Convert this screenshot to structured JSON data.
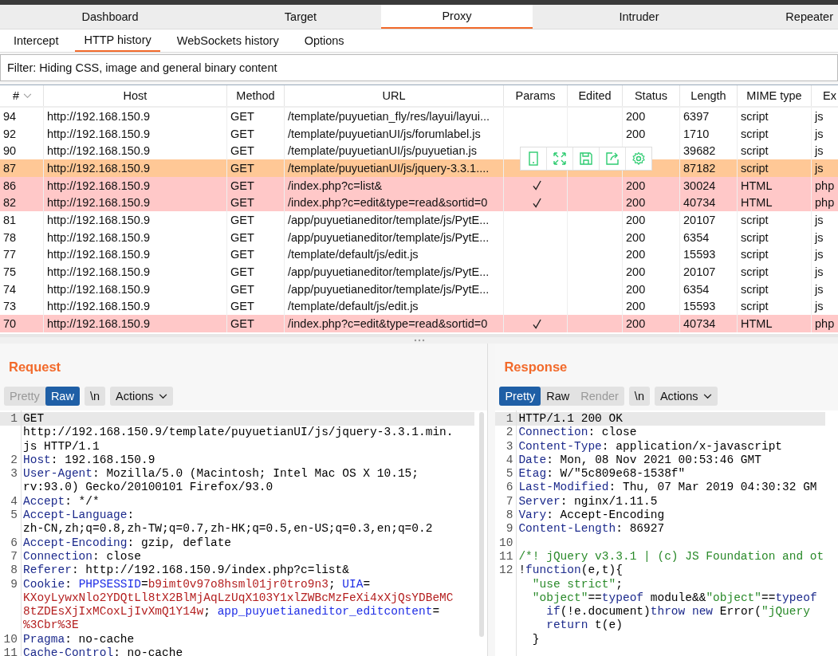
{
  "main_tabs": [
    {
      "label": "Dashboard",
      "selected": false
    },
    {
      "label": "Target",
      "selected": false
    },
    {
      "label": "Proxy",
      "selected": true
    },
    {
      "label": "Intruder",
      "selected": false
    },
    {
      "label": "Repeater",
      "selected": false
    }
  ],
  "sub_tabs": [
    {
      "label": "Intercept",
      "selected": false
    },
    {
      "label": "HTTP history",
      "selected": true
    },
    {
      "label": "WebSockets history",
      "selected": false
    },
    {
      "label": "Options",
      "selected": false
    }
  ],
  "filter": "Filter: Hiding CSS, image and general binary content",
  "table": {
    "columns": [
      "#",
      "Host",
      "Method",
      "URL",
      "Params",
      "Edited",
      "Status",
      "Length",
      "MIME type",
      "Ex"
    ],
    "rows": [
      {
        "number": "94",
        "host": "http://192.168.150.9",
        "method": "GET",
        "url": "/template/puyuetian_fly/res/layui/layui...",
        "params": false,
        "status": "200",
        "length": "6397",
        "mime": "script",
        "ext": "js"
      },
      {
        "number": "92",
        "host": "http://192.168.150.9",
        "method": "GET",
        "url": "/template/puyuetianUI/js/forumlabel.js",
        "params": false,
        "status": "200",
        "length": "1710",
        "mime": "script",
        "ext": "js"
      },
      {
        "number": "90",
        "host": "http://192.168.150.9",
        "method": "GET",
        "url": "/template/puyuetianUI/js/puyuetian.js",
        "length": "39682",
        "mime": "script",
        "ext": "js"
      },
      {
        "number": "87",
        "host": "http://192.168.150.9",
        "method": "GET",
        "url": "/template/puyuetianUI/js/jquery-3.3.1....",
        "params": false,
        "length": "87182",
        "mime": "script",
        "ext": "js",
        "color": "#ffc896"
      },
      {
        "number": "86",
        "host": "http://192.168.150.9",
        "method": "GET",
        "url": "/index.php?c=list&",
        "params": true,
        "status": "200",
        "length": "30024",
        "mime": "HTML",
        "ext": "php",
        "color": "#ffc8c8"
      },
      {
        "number": "82",
        "host": "http://192.168.150.9",
        "method": "GET",
        "url": "/index.php?c=edit&type=read&sortid=0",
        "params": true,
        "status": "200",
        "length": "40734",
        "mime": "HTML",
        "ext": "php",
        "color": "#ffc8c8"
      },
      {
        "number": "81",
        "host": "http://192.168.150.9",
        "method": "GET",
        "url": "/app/puyuetianeditor/template/js/PytE...",
        "params": false,
        "status": "200",
        "length": "20107",
        "mime": "script",
        "ext": "js"
      },
      {
        "number": "78",
        "host": "http://192.168.150.9",
        "method": "GET",
        "url": "/app/puyuetianeditor/template/js/PytE...",
        "params": false,
        "status": "200",
        "length": "6354",
        "mime": "script",
        "ext": "js"
      },
      {
        "number": "77",
        "host": "http://192.168.150.9",
        "method": "GET",
        "url": "/template/default/js/edit.js",
        "params": false,
        "status": "200",
        "length": "15593",
        "mime": "script",
        "ext": "js"
      },
      {
        "number": "75",
        "host": "http://192.168.150.9",
        "method": "GET",
        "url": "/app/puyuetianeditor/template/js/PytE...",
        "params": false,
        "status": "200",
        "length": "20107",
        "mime": "script",
        "ext": "js"
      },
      {
        "number": "74",
        "host": "http://192.168.150.9",
        "method": "GET",
        "url": "/app/puyuetianeditor/template/js/PytE...",
        "params": false,
        "status": "200",
        "length": "6354",
        "mime": "script",
        "ext": "js"
      },
      {
        "number": "73",
        "host": "http://192.168.150.9",
        "method": "GET",
        "url": "/template/default/js/edit.js",
        "params": false,
        "status": "200",
        "length": "15593",
        "mime": "script",
        "ext": "js"
      },
      {
        "number": "70",
        "host": "http://192.168.150.9",
        "method": "GET",
        "url": "/index.php?c=edit&type=read&sortid=0",
        "params": true,
        "status": "200",
        "length": "40734",
        "mime": "HTML",
        "ext": "php",
        "color": "#ffc8c8"
      }
    ]
  },
  "panels": [
    {
      "title": "Request",
      "views": [
        {
          "label": "Pretty",
          "selected": false,
          "disabled": true
        },
        {
          "label": "Raw",
          "selected": true,
          "disabled": false
        }
      ],
      "newline_button": "\\n",
      "actions_button": "Actions",
      "lines": [
        {
          "number": "1",
          "current": true,
          "segments": [
            {
              "kind": "plain",
              "text": "GET"
            }
          ]
        },
        {
          "current": false,
          "segments": [
            {
              "kind": "plain",
              "text": "http://192.168.150.9/template/puyuetianUI/js/jquery-3.3.1.min."
            }
          ]
        },
        {
          "current": false,
          "segments": [
            {
              "kind": "plain",
              "text": "js HTTP/1.1"
            }
          ]
        },
        {
          "number": "2",
          "current": false,
          "segments": [
            {
              "kind": "key",
              "text": "Host"
            },
            {
              "kind": "plain",
              "text": ": 192.168.150.9"
            }
          ]
        },
        {
          "number": "3",
          "current": false,
          "segments": [
            {
              "kind": "key",
              "text": "User-Agent"
            },
            {
              "kind": "plain",
              "text": ": Mozilla/5.0 (Macintosh; Intel Mac OS X 10.15;"
            }
          ]
        },
        {
          "current": false,
          "segments": [
            {
              "kind": "plain",
              "text": "rv:93.0) Gecko/20100101 Firefox/93.0"
            }
          ]
        },
        {
          "number": "4",
          "current": false,
          "segments": [
            {
              "kind": "key",
              "text": "Accept"
            },
            {
              "kind": "plain",
              "text": ": */*"
            }
          ]
        },
        {
          "number": "5",
          "current": false,
          "segments": [
            {
              "kind": "key",
              "text": "Accept-Language"
            },
            {
              "kind": "plain",
              "text": ":"
            }
          ]
        },
        {
          "current": false,
          "segments": [
            {
              "kind": "plain",
              "text": "zh-CN,zh;q=0.8,zh-TW;q=0.7,zh-HK;q=0.5,en-US;q=0.3,en;q=0.2"
            }
          ]
        },
        {
          "number": "6",
          "current": false,
          "segments": [
            {
              "kind": "key",
              "text": "Accept-Encoding"
            },
            {
              "kind": "plain",
              "text": ": gzip, deflate"
            }
          ]
        },
        {
          "number": "7",
          "current": false,
          "segments": [
            {
              "kind": "key",
              "text": "Connection"
            },
            {
              "kind": "plain",
              "text": ": close"
            }
          ]
        },
        {
          "number": "8",
          "current": false,
          "segments": [
            {
              "kind": "key",
              "text": "Referer"
            },
            {
              "kind": "plain",
              "text": ": http://192.168.150.9/index.php?c=list&"
            }
          ]
        },
        {
          "number": "9",
          "current": false,
          "segments": [
            {
              "kind": "key",
              "text": "Cookie"
            },
            {
              "kind": "plain",
              "text": ": "
            },
            {
              "kind": "cookie-name",
              "text": "PHPSESSID"
            },
            {
              "kind": "plain",
              "text": "="
            },
            {
              "kind": "cookie-value",
              "text": "b9imt0v97o8hsml01jr0tro9n3"
            },
            {
              "kind": "plain",
              "text": "; "
            },
            {
              "kind": "cookie-name",
              "text": "UIA"
            },
            {
              "kind": "plain",
              "text": "="
            }
          ]
        },
        {
          "current": false,
          "segments": [
            {
              "kind": "cookie-value",
              "text": "KXoyLywxNlo2YDQtLl8tX2BlMjAqLzUqX103Y1xlZWBcMzFeXi4xXjQsYDBeMC"
            }
          ]
        },
        {
          "current": false,
          "segments": [
            {
              "kind": "cookie-value",
              "text": "8tZDEsXjIxMCoxLjIvXmQ1Y14w"
            },
            {
              "kind": "plain",
              "text": "; "
            },
            {
              "kind": "cookie-name",
              "text": "app_puyuetianeditor_editcontent"
            },
            {
              "kind": "plain",
              "text": "="
            }
          ]
        },
        {
          "current": false,
          "segments": [
            {
              "kind": "cookie-value",
              "text": "%3Cbr%3E"
            }
          ]
        },
        {
          "number": "10",
          "current": false,
          "segments": [
            {
              "kind": "key",
              "text": "Pragma"
            },
            {
              "kind": "plain",
              "text": ": no-cache"
            }
          ]
        },
        {
          "number": "11",
          "current": false,
          "segments": [
            {
              "kind": "key",
              "text": "Cache-Control"
            },
            {
              "kind": "plain",
              "text": ": no-cache"
            }
          ]
        }
      ]
    },
    {
      "title": "Response",
      "views": [
        {
          "label": "Pretty",
          "selected": true,
          "disabled": false
        },
        {
          "label": "Raw",
          "selected": false,
          "disabled": false
        },
        {
          "label": "Render",
          "selected": false,
          "disabled": true
        }
      ],
      "newline_button": "\\n",
      "actions_button": "Actions",
      "lines": [
        {
          "number": "1",
          "current": true,
          "segments": [
            {
              "kind": "plain",
              "text": "HTTP/1.1 200 OK"
            }
          ]
        },
        {
          "number": "2",
          "current": false,
          "segments": [
            {
              "kind": "key",
              "text": "Connection"
            },
            {
              "kind": "plain",
              "text": ": close"
            }
          ]
        },
        {
          "number": "3",
          "current": false,
          "segments": [
            {
              "kind": "key",
              "text": "Content-Type"
            },
            {
              "kind": "plain",
              "text": ": application/x-javascript"
            }
          ]
        },
        {
          "number": "4",
          "current": false,
          "segments": [
            {
              "kind": "key",
              "text": "Date"
            },
            {
              "kind": "plain",
              "text": ": Mon, 08 Nov 2021 00:53:46 GMT"
            }
          ]
        },
        {
          "number": "5",
          "current": false,
          "segments": [
            {
              "kind": "key",
              "text": "Etag"
            },
            {
              "kind": "plain",
              "text": ": W/\"5c809e68-1538f\""
            }
          ]
        },
        {
          "number": "6",
          "current": false,
          "segments": [
            {
              "kind": "key",
              "text": "Last-Modified"
            },
            {
              "kind": "plain",
              "text": ": Thu, 07 Mar 2019 04:30:32 GM"
            }
          ]
        },
        {
          "number": "7",
          "current": false,
          "segments": [
            {
              "kind": "key",
              "text": "Server"
            },
            {
              "kind": "plain",
              "text": ": nginx/1.11.5"
            }
          ]
        },
        {
          "number": "8",
          "current": false,
          "segments": [
            {
              "kind": "key",
              "text": "Vary"
            },
            {
              "kind": "plain",
              "text": ": Accept-Encoding"
            }
          ]
        },
        {
          "number": "9",
          "current": false,
          "segments": [
            {
              "kind": "key",
              "text": "Content-Length"
            },
            {
              "kind": "plain",
              "text": ": 86927"
            }
          ]
        },
        {
          "number": "10",
          "current": false
        },
        {
          "number": "11",
          "current": false,
          "segments": [
            {
              "kind": "string",
              "text": "/*! jQuery v3.3.1 | (c) JS Foundation and ot"
            }
          ]
        },
        {
          "number": "12",
          "current": false,
          "segments": [
            {
              "kind": "plain",
              "text": "!"
            },
            {
              "kind": "keyword",
              "text": "function"
            },
            {
              "kind": "plain",
              "text": "(e,t){"
            }
          ]
        },
        {
          "current": false,
          "segments": [
            {
              "kind": "string",
              "text": "  \"use strict\""
            },
            {
              "kind": "plain",
              "text": ";"
            }
          ]
        },
        {
          "current": false,
          "segments": [
            {
              "kind": "string",
              "text": "  \"object\""
            },
            {
              "kind": "plain",
              "text": "=="
            },
            {
              "kind": "keyword",
              "text": "typeof"
            },
            {
              "kind": "plain",
              "text": " module&&"
            },
            {
              "kind": "string",
              "text": "\"object\""
            },
            {
              "kind": "plain",
              "text": "=="
            },
            {
              "kind": "keyword",
              "text": "typeof"
            }
          ]
        },
        {
          "current": false,
          "segments": [
            {
              "kind": "keyword",
              "text": "    if"
            },
            {
              "kind": "plain",
              "text": "(!e.document)"
            },
            {
              "kind": "keyword",
              "text": "throw new"
            },
            {
              "kind": "plain",
              "text": " Error("
            },
            {
              "kind": "string",
              "text": "\"jQuery"
            }
          ]
        },
        {
          "current": false,
          "segments": [
            {
              "kind": "keyword",
              "text": "    return"
            },
            {
              "kind": "plain",
              "text": " t(e)"
            }
          ]
        },
        {
          "current": false,
          "segments": [
            {
              "kind": "plain",
              "text": "  }"
            }
          ]
        }
      ]
    }
  ]
}
